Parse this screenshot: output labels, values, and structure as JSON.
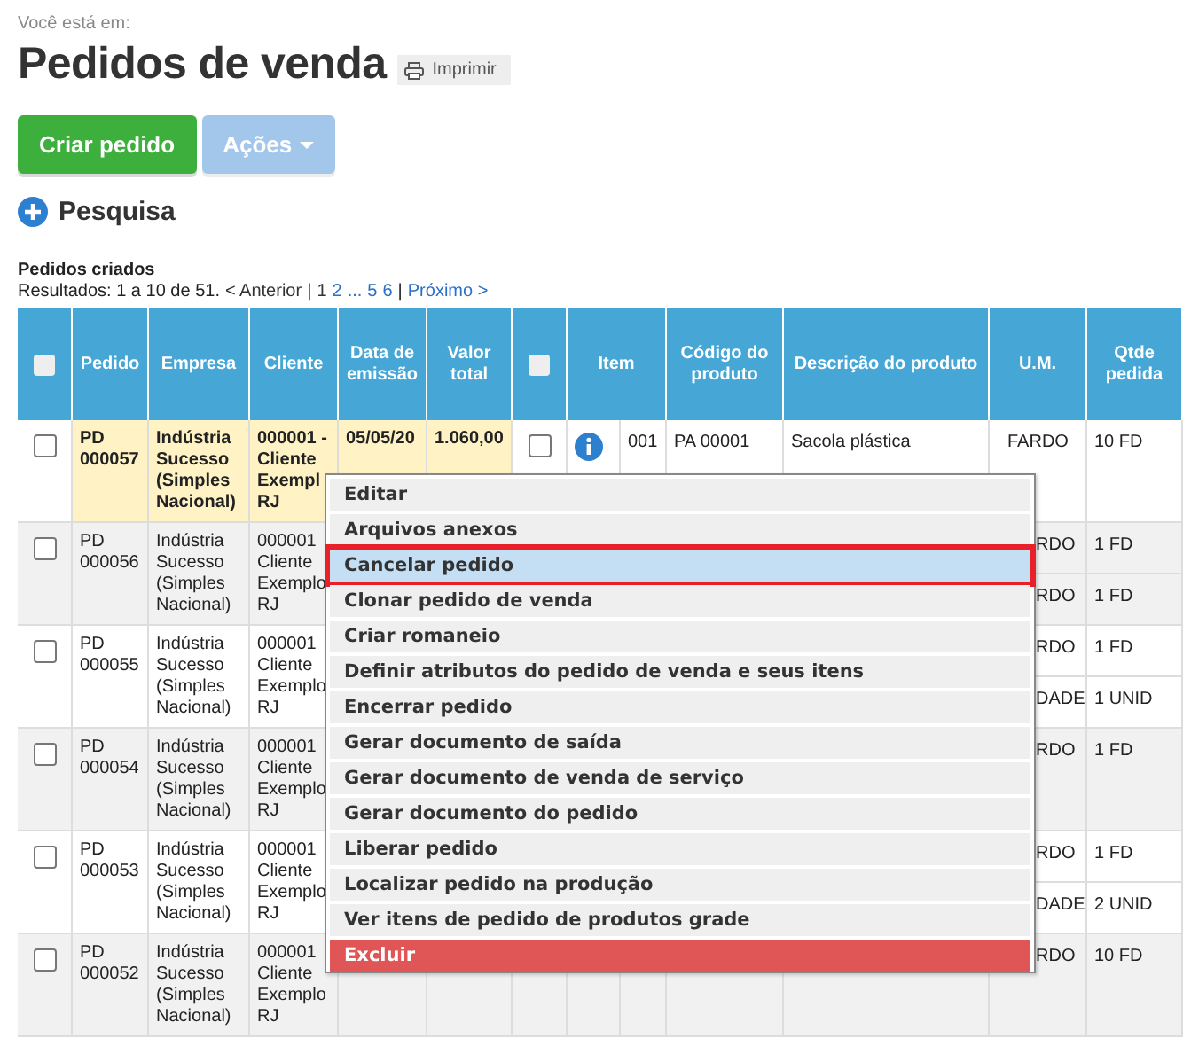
{
  "breadcrumb": "Você está em:",
  "title": "Pedidos de venda",
  "print_button": "Imprimir",
  "actions": [
    {
      "label": "Criar pedido",
      "kind": "primary",
      "disabled": false
    },
    {
      "label": "Ações",
      "kind": "dropdown",
      "disabled": true
    }
  ],
  "search_toggle": "Pesquisa",
  "results": {
    "title": "Pedidos criados",
    "summary": "Resultados: 1 a 10 de 51.",
    "previous": "< Anterior",
    "separator": "|",
    "pages": [
      {
        "label": "1",
        "selected": true
      },
      {
        "label": "2",
        "selected": false
      },
      {
        "label": "...",
        "selected": false
      },
      {
        "label": "5",
        "selected": false
      },
      {
        "label": "6",
        "selected": false
      }
    ],
    "next": "Próximo >"
  },
  "table": {
    "columns": [
      {
        "kind": "checkbox",
        "checked": false
      },
      {
        "kind": "text",
        "label": "Pedido"
      },
      {
        "kind": "text",
        "label": "Empresa"
      },
      {
        "kind": "text",
        "label": "Cliente"
      },
      {
        "kind": "text",
        "label": "Data de emissão"
      },
      {
        "kind": "text",
        "label": "Valor total"
      },
      {
        "kind": "checkbox",
        "checked": false
      },
      {
        "kind": "text",
        "label": "Item"
      },
      {
        "kind": "text",
        "label": "Código do produto"
      },
      {
        "kind": "text",
        "label": "Descrição do produto"
      },
      {
        "kind": "text",
        "label": "U.M."
      },
      {
        "kind": "text",
        "label": "Qtde pedida"
      }
    ],
    "rows": [
      {
        "selected": true,
        "checked": false,
        "pedido": "PD 000057",
        "empresa": "Indústria Sucesso (Simples Nacional)",
        "cliente": "000001 - Cliente Exempl RJ",
        "data": "05/05/20",
        "valor": "1.060,00",
        "items": [
          {
            "checked": false,
            "info": true,
            "numero": "001",
            "codigo": "PA 00001",
            "descricao": "Sacola plástica",
            "um": "FARDO",
            "qtde": "10 FD"
          }
        ]
      },
      {
        "selected": false,
        "checked": false,
        "pedido": "PD 000056",
        "empresa": "Indústria Sucesso (Simples Nacional)",
        "cliente": "000001 Cliente Exemplo RJ",
        "items": [
          {
            "um": "RDO",
            "qtde": "1 FD"
          },
          {
            "um": "RDO",
            "qtde": "1 FD"
          }
        ]
      },
      {
        "selected": false,
        "checked": false,
        "pedido": "PD 000055",
        "empresa": "Indústria Sucesso (Simples Nacional)",
        "cliente": "000001 Cliente Exemplo RJ",
        "items": [
          {
            "um": "RDO",
            "qtde": "1 FD"
          },
          {
            "um": "DADE",
            "qtde": "1 UNID"
          }
        ]
      },
      {
        "selected": false,
        "checked": false,
        "pedido": "PD 000054",
        "empresa": "Indústria Sucesso (Simples Nacional)",
        "cliente": "000001 Cliente Exemplo RJ",
        "items": [
          {
            "um": "RDO",
            "qtde": "1 FD"
          }
        ]
      },
      {
        "selected": false,
        "checked": false,
        "pedido": "PD 000053",
        "empresa": "Indústria Sucesso (Simples Nacional)",
        "cliente": "000001 Cliente Exemplo RJ",
        "items": [
          {
            "um": "RDO",
            "qtde": "1 FD"
          },
          {
            "um": "DADE",
            "qtde": "2 UNID"
          }
        ]
      },
      {
        "selected": false,
        "checked": false,
        "pedido": "PD 000052",
        "empresa": "Indústria Sucesso (Simples Nacional)",
        "cliente": "000001 Cliente Exemplo RJ",
        "items": [
          {
            "um": "RDO",
            "qtde": "10 FD"
          }
        ]
      }
    ]
  },
  "context_menu": [
    {
      "label": "Editar",
      "kind": "normal",
      "selected": false
    },
    {
      "label": "Arquivos anexos",
      "kind": "normal",
      "selected": false
    },
    {
      "label": "Cancelar pedido",
      "kind": "normal",
      "selected": true
    },
    {
      "label": "Clonar pedido de venda",
      "kind": "normal",
      "selected": false
    },
    {
      "label": "Criar romaneio",
      "kind": "normal",
      "selected": false
    },
    {
      "label": "Definir atributos do pedido de venda e seus itens",
      "kind": "normal",
      "selected": false
    },
    {
      "label": "Encerrar pedido",
      "kind": "normal",
      "selected": false
    },
    {
      "label": "Gerar documento de saída",
      "kind": "normal",
      "selected": false
    },
    {
      "label": "Gerar documento de venda de serviço",
      "kind": "normal",
      "selected": false
    },
    {
      "label": "Gerar documento do pedido",
      "kind": "normal",
      "selected": false
    },
    {
      "label": "Liberar pedido",
      "kind": "normal",
      "selected": false
    },
    {
      "label": "Localizar pedido na produção",
      "kind": "normal",
      "selected": false
    },
    {
      "label": "Ver itens de pedido de produtos grade",
      "kind": "normal",
      "selected": false
    },
    {
      "label": "Excluir",
      "kind": "danger",
      "selected": false
    }
  ]
}
